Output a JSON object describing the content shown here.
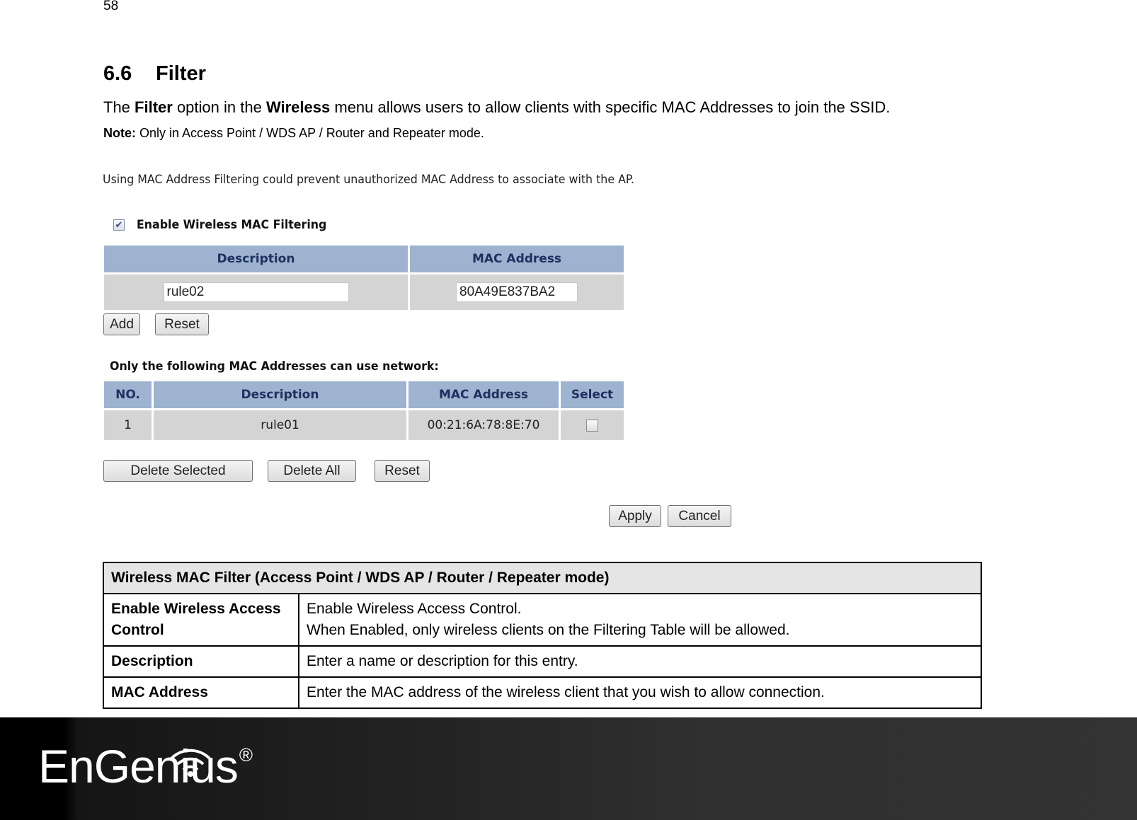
{
  "page": {
    "number": "58",
    "section_number": "6.6",
    "section_title": "Filter",
    "intro": {
      "pre": "The ",
      "b1": "Filter",
      "mid": " option in the ",
      "b2": "Wireless",
      "post": " menu allows users to allow clients with specific MAC Addresses to join the SSID."
    },
    "note": {
      "label": "Note:",
      "text": " Only in Access Point / WDS AP / Router and Repeater mode."
    }
  },
  "ui": {
    "message": "Using MAC Address Filtering could prevent unauthorized MAC Address to associate with the AP.",
    "enable_filter": {
      "label": "Enable Wireless MAC Filtering",
      "checked": true
    },
    "entry_table": {
      "headers": [
        "Description",
        "MAC Address"
      ],
      "description_value": "rule02",
      "mac_value": "80A49E837BA2"
    },
    "add_label": "Add",
    "reset_label": "Reset",
    "list_label": "Only the following MAC Addresses can use network:",
    "list_table": {
      "headers": [
        "NO.",
        "Description",
        "MAC Address",
        "Select"
      ],
      "rows": [
        {
          "no": "1",
          "description": "rule01",
          "mac": "00:21:6A:78:8E:70",
          "selected": false
        }
      ]
    },
    "delete_selected_label": "Delete Selected",
    "delete_all_label": "Delete All",
    "list_reset_label": "Reset",
    "apply_label": "Apply",
    "cancel_label": "Cancel",
    "colors": {
      "header_bg": "#9eb3cf",
      "header_text": "#1e3160",
      "cell_bg": "#d4d4d4"
    }
  },
  "desc_table": {
    "title": "Wireless MAC Filter (Access Point / WDS AP / Router / Repeater mode)",
    "rows": [
      {
        "key": "Enable Wireless Access Control",
        "value_line1": "Enable Wireless Access Control.",
        "value_line2": "When Enabled, only wireless clients on the Filtering Table will be allowed."
      },
      {
        "key": "Description",
        "value_line1": "Enter a name or description for this entry."
      },
      {
        "key": "MAC Address",
        "value_line1": "Enter the MAC address of the wireless client that you wish to allow connection."
      }
    ]
  },
  "footer": {
    "brand": "EnGenius",
    "registered": "®",
    "logo_icon": "wifi-icon"
  }
}
